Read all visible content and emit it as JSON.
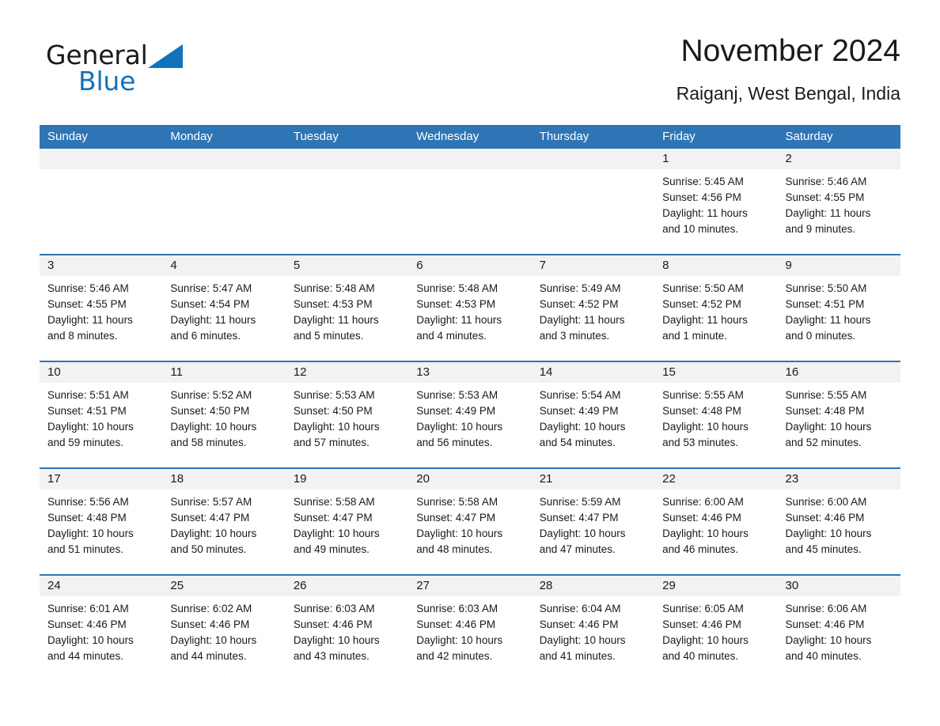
{
  "brand": {
    "name_top": "General",
    "name_bottom": "Blue",
    "triangle_color": "#1273bd",
    "text_color": "#1a1a1a"
  },
  "header": {
    "title": "November 2024",
    "subtitle": "Raiganj, West Bengal, India"
  },
  "theme": {
    "header_blue": "#2e75b6",
    "day_band_gray": "#f2f2f2",
    "cell_white": "#ffffff",
    "text": "#1a1a1a"
  },
  "weekdays": [
    "Sunday",
    "Monday",
    "Tuesday",
    "Wednesday",
    "Thursday",
    "Friday",
    "Saturday"
  ],
  "weeks": [
    [
      {
        "day": "",
        "sunrise": "",
        "sunset": "",
        "daylight_line1": "",
        "daylight_line2": "",
        "empty": true
      },
      {
        "day": "",
        "sunrise": "",
        "sunset": "",
        "daylight_line1": "",
        "daylight_line2": "",
        "empty": true
      },
      {
        "day": "",
        "sunrise": "",
        "sunset": "",
        "daylight_line1": "",
        "daylight_line2": "",
        "empty": true
      },
      {
        "day": "",
        "sunrise": "",
        "sunset": "",
        "daylight_line1": "",
        "daylight_line2": "",
        "empty": true
      },
      {
        "day": "",
        "sunrise": "",
        "sunset": "",
        "daylight_line1": "",
        "daylight_line2": "",
        "empty": true
      },
      {
        "day": "1",
        "sunrise": "Sunrise: 5:45 AM",
        "sunset": "Sunset: 4:56 PM",
        "daylight_line1": "Daylight: 11 hours",
        "daylight_line2": "and 10 minutes.",
        "empty": false
      },
      {
        "day": "2",
        "sunrise": "Sunrise: 5:46 AM",
        "sunset": "Sunset: 4:55 PM",
        "daylight_line1": "Daylight: 11 hours",
        "daylight_line2": "and 9 minutes.",
        "empty": false
      }
    ],
    [
      {
        "day": "3",
        "sunrise": "Sunrise: 5:46 AM",
        "sunset": "Sunset: 4:55 PM",
        "daylight_line1": "Daylight: 11 hours",
        "daylight_line2": "and 8 minutes.",
        "empty": false
      },
      {
        "day": "4",
        "sunrise": "Sunrise: 5:47 AM",
        "sunset": "Sunset: 4:54 PM",
        "daylight_line1": "Daylight: 11 hours",
        "daylight_line2": "and 6 minutes.",
        "empty": false
      },
      {
        "day": "5",
        "sunrise": "Sunrise: 5:48 AM",
        "sunset": "Sunset: 4:53 PM",
        "daylight_line1": "Daylight: 11 hours",
        "daylight_line2": "and 5 minutes.",
        "empty": false
      },
      {
        "day": "6",
        "sunrise": "Sunrise: 5:48 AM",
        "sunset": "Sunset: 4:53 PM",
        "daylight_line1": "Daylight: 11 hours",
        "daylight_line2": "and 4 minutes.",
        "empty": false
      },
      {
        "day": "7",
        "sunrise": "Sunrise: 5:49 AM",
        "sunset": "Sunset: 4:52 PM",
        "daylight_line1": "Daylight: 11 hours",
        "daylight_line2": "and 3 minutes.",
        "empty": false
      },
      {
        "day": "8",
        "sunrise": "Sunrise: 5:50 AM",
        "sunset": "Sunset: 4:52 PM",
        "daylight_line1": "Daylight: 11 hours",
        "daylight_line2": "and 1 minute.",
        "empty": false
      },
      {
        "day": "9",
        "sunrise": "Sunrise: 5:50 AM",
        "sunset": "Sunset: 4:51 PM",
        "daylight_line1": "Daylight: 11 hours",
        "daylight_line2": "and 0 minutes.",
        "empty": false
      }
    ],
    [
      {
        "day": "10",
        "sunrise": "Sunrise: 5:51 AM",
        "sunset": "Sunset: 4:51 PM",
        "daylight_line1": "Daylight: 10 hours",
        "daylight_line2": "and 59 minutes.",
        "empty": false
      },
      {
        "day": "11",
        "sunrise": "Sunrise: 5:52 AM",
        "sunset": "Sunset: 4:50 PM",
        "daylight_line1": "Daylight: 10 hours",
        "daylight_line2": "and 58 minutes.",
        "empty": false
      },
      {
        "day": "12",
        "sunrise": "Sunrise: 5:53 AM",
        "sunset": "Sunset: 4:50 PM",
        "daylight_line1": "Daylight: 10 hours",
        "daylight_line2": "and 57 minutes.",
        "empty": false
      },
      {
        "day": "13",
        "sunrise": "Sunrise: 5:53 AM",
        "sunset": "Sunset: 4:49 PM",
        "daylight_line1": "Daylight: 10 hours",
        "daylight_line2": "and 56 minutes.",
        "empty": false
      },
      {
        "day": "14",
        "sunrise": "Sunrise: 5:54 AM",
        "sunset": "Sunset: 4:49 PM",
        "daylight_line1": "Daylight: 10 hours",
        "daylight_line2": "and 54 minutes.",
        "empty": false
      },
      {
        "day": "15",
        "sunrise": "Sunrise: 5:55 AM",
        "sunset": "Sunset: 4:48 PM",
        "daylight_line1": "Daylight: 10 hours",
        "daylight_line2": "and 53 minutes.",
        "empty": false
      },
      {
        "day": "16",
        "sunrise": "Sunrise: 5:55 AM",
        "sunset": "Sunset: 4:48 PM",
        "daylight_line1": "Daylight: 10 hours",
        "daylight_line2": "and 52 minutes.",
        "empty": false
      }
    ],
    [
      {
        "day": "17",
        "sunrise": "Sunrise: 5:56 AM",
        "sunset": "Sunset: 4:48 PM",
        "daylight_line1": "Daylight: 10 hours",
        "daylight_line2": "and 51 minutes.",
        "empty": false
      },
      {
        "day": "18",
        "sunrise": "Sunrise: 5:57 AM",
        "sunset": "Sunset: 4:47 PM",
        "daylight_line1": "Daylight: 10 hours",
        "daylight_line2": "and 50 minutes.",
        "empty": false
      },
      {
        "day": "19",
        "sunrise": "Sunrise: 5:58 AM",
        "sunset": "Sunset: 4:47 PM",
        "daylight_line1": "Daylight: 10 hours",
        "daylight_line2": "and 49 minutes.",
        "empty": false
      },
      {
        "day": "20",
        "sunrise": "Sunrise: 5:58 AM",
        "sunset": "Sunset: 4:47 PM",
        "daylight_line1": "Daylight: 10 hours",
        "daylight_line2": "and 48 minutes.",
        "empty": false
      },
      {
        "day": "21",
        "sunrise": "Sunrise: 5:59 AM",
        "sunset": "Sunset: 4:47 PM",
        "daylight_line1": "Daylight: 10 hours",
        "daylight_line2": "and 47 minutes.",
        "empty": false
      },
      {
        "day": "22",
        "sunrise": "Sunrise: 6:00 AM",
        "sunset": "Sunset: 4:46 PM",
        "daylight_line1": "Daylight: 10 hours",
        "daylight_line2": "and 46 minutes.",
        "empty": false
      },
      {
        "day": "23",
        "sunrise": "Sunrise: 6:00 AM",
        "sunset": "Sunset: 4:46 PM",
        "daylight_line1": "Daylight: 10 hours",
        "daylight_line2": "and 45 minutes.",
        "empty": false
      }
    ],
    [
      {
        "day": "24",
        "sunrise": "Sunrise: 6:01 AM",
        "sunset": "Sunset: 4:46 PM",
        "daylight_line1": "Daylight: 10 hours",
        "daylight_line2": "and 44 minutes.",
        "empty": false
      },
      {
        "day": "25",
        "sunrise": "Sunrise: 6:02 AM",
        "sunset": "Sunset: 4:46 PM",
        "daylight_line1": "Daylight: 10 hours",
        "daylight_line2": "and 44 minutes.",
        "empty": false
      },
      {
        "day": "26",
        "sunrise": "Sunrise: 6:03 AM",
        "sunset": "Sunset: 4:46 PM",
        "daylight_line1": "Daylight: 10 hours",
        "daylight_line2": "and 43 minutes.",
        "empty": false
      },
      {
        "day": "27",
        "sunrise": "Sunrise: 6:03 AM",
        "sunset": "Sunset: 4:46 PM",
        "daylight_line1": "Daylight: 10 hours",
        "daylight_line2": "and 42 minutes.",
        "empty": false
      },
      {
        "day": "28",
        "sunrise": "Sunrise: 6:04 AM",
        "sunset": "Sunset: 4:46 PM",
        "daylight_line1": "Daylight: 10 hours",
        "daylight_line2": "and 41 minutes.",
        "empty": false
      },
      {
        "day": "29",
        "sunrise": "Sunrise: 6:05 AM",
        "sunset": "Sunset: 4:46 PM",
        "daylight_line1": "Daylight: 10 hours",
        "daylight_line2": "and 40 minutes.",
        "empty": false
      },
      {
        "day": "30",
        "sunrise": "Sunrise: 6:06 AM",
        "sunset": "Sunset: 4:46 PM",
        "daylight_line1": "Daylight: 10 hours",
        "daylight_line2": "and 40 minutes.",
        "empty": false
      }
    ]
  ]
}
